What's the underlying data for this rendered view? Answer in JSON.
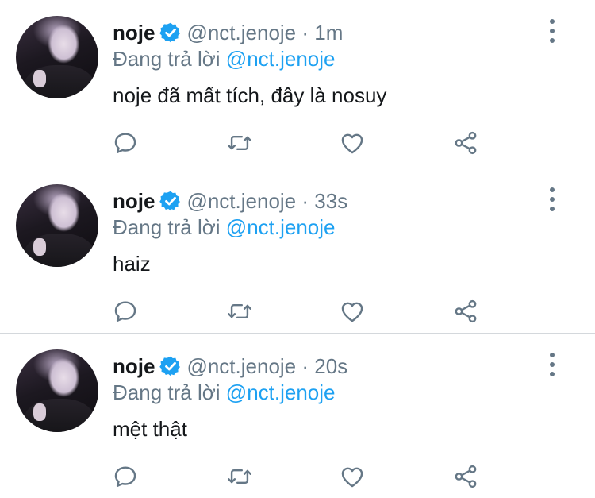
{
  "colors": {
    "text": "#14171a",
    "secondary": "#657786",
    "accent": "#1da1f2",
    "divider": "#d4d8dc"
  },
  "icons": {
    "verified": "verified-badge-icon",
    "more": "more-vertical-icon",
    "reply": "reply-bubble-icon",
    "retweet": "retweet-icon",
    "like": "heart-icon",
    "share": "share-icon"
  },
  "tweets": [
    {
      "name": "noje",
      "handle": "@nct.jenoje",
      "separator": "·",
      "time": "1m",
      "reply_prefix": "Đang trả lời",
      "reply_to": "@nct.jenoje",
      "text": "noje đã mất tích, đây là nosuy"
    },
    {
      "name": "noje",
      "handle": "@nct.jenoje",
      "separator": "·",
      "time": "33s",
      "reply_prefix": "Đang trả lời",
      "reply_to": "@nct.jenoje",
      "text": "haiz"
    },
    {
      "name": "noje",
      "handle": "@nct.jenoje",
      "separator": "·",
      "time": "20s",
      "reply_prefix": "Đang trả lời",
      "reply_to": "@nct.jenoje",
      "text": "mệt thật"
    }
  ]
}
